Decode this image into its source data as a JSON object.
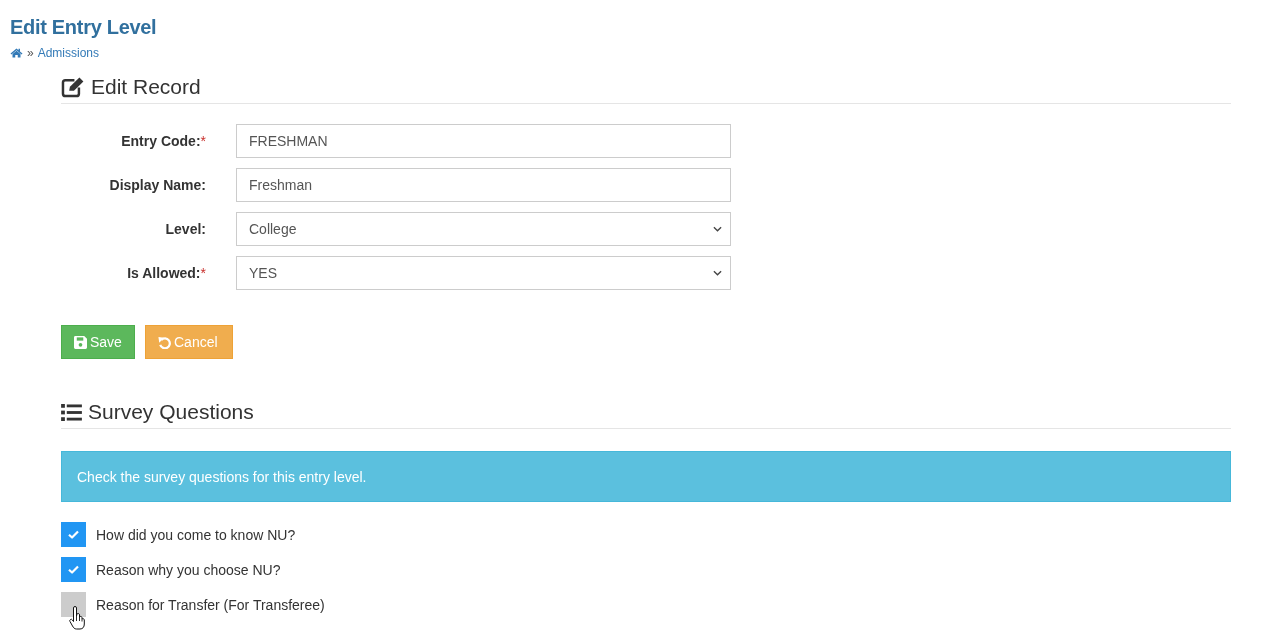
{
  "page": {
    "title": "Edit Entry Level"
  },
  "breadcrumb": {
    "separator": "»",
    "items": [
      {
        "label": "Admissions"
      }
    ]
  },
  "edit_record": {
    "heading": "Edit Record",
    "fields": [
      {
        "kind": "text",
        "label": "Entry Code:",
        "required_mark": "*",
        "value": "FRESHMAN"
      },
      {
        "kind": "text",
        "label": "Display Name:",
        "value": "Freshman"
      },
      {
        "kind": "select",
        "label": "Level:",
        "value": "College"
      },
      {
        "kind": "select",
        "label": "Is Allowed:",
        "required_mark": "*",
        "value": "YES"
      }
    ],
    "buttons": [
      {
        "kind": "save",
        "label": "Save"
      },
      {
        "kind": "cancel",
        "label": "Cancel"
      }
    ]
  },
  "survey_questions": {
    "heading": "Survey Questions",
    "alert": "Check the survey questions for this entry level.",
    "questions": [
      {
        "label": "How did you come to know NU?",
        "checked": true
      },
      {
        "label": "Reason why you choose NU?",
        "checked": true
      },
      {
        "label": "Reason for Transfer (For Transferee)",
        "checked": false
      }
    ]
  }
}
